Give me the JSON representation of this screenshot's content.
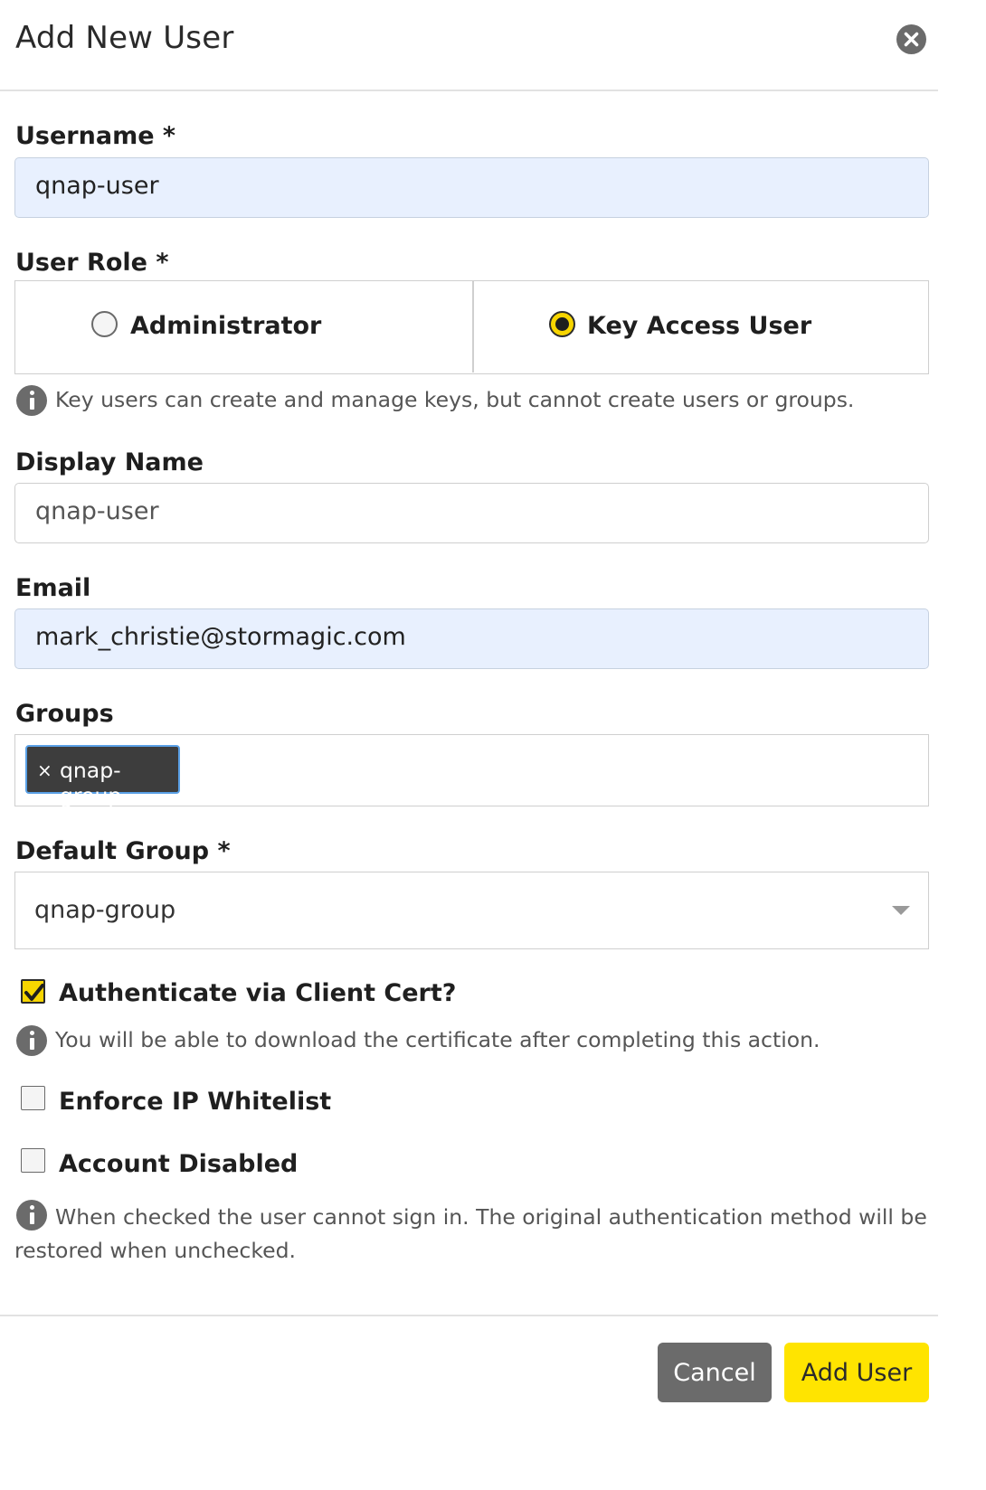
{
  "dialog": {
    "title": "Add New User"
  },
  "username": {
    "label": "Username *",
    "value": "qnap-user"
  },
  "user_role": {
    "label": "User Role *",
    "options": [
      {
        "label": "Administrator",
        "selected": false
      },
      {
        "label": "Key Access User",
        "selected": true
      }
    ],
    "info": "Key users can create and manage keys, but cannot create users or groups."
  },
  "display_name": {
    "label": "Display Name",
    "value": "qnap-user"
  },
  "email": {
    "label": "Email",
    "value": "mark_christie@stormagic.com"
  },
  "groups": {
    "label": "Groups",
    "chips": [
      {
        "remove": "×",
        "label": "qnap-group"
      }
    ]
  },
  "default_group": {
    "label": "Default Group *",
    "value": "qnap-group"
  },
  "client_cert": {
    "label": "Authenticate via Client Cert?",
    "checked": true,
    "info": "You will be able to download the certificate after completing this action."
  },
  "ip_whitelist": {
    "label": "Enforce IP Whitelist",
    "checked": false
  },
  "account_disabled": {
    "label": "Account Disabled",
    "checked": false,
    "info_line1": "When checked the user cannot sign in. The original authentication method will be",
    "info_line2": "restored when unchecked."
  },
  "footer": {
    "cancel_label": "Cancel",
    "add_label": "Add User"
  },
  "colors": {
    "accent": "#ffe400",
    "selected_radio": "#f7d500",
    "cancel_button": "#6b6b6b",
    "chip": "#3d3d3d",
    "autofill": "#e8f0fe"
  }
}
